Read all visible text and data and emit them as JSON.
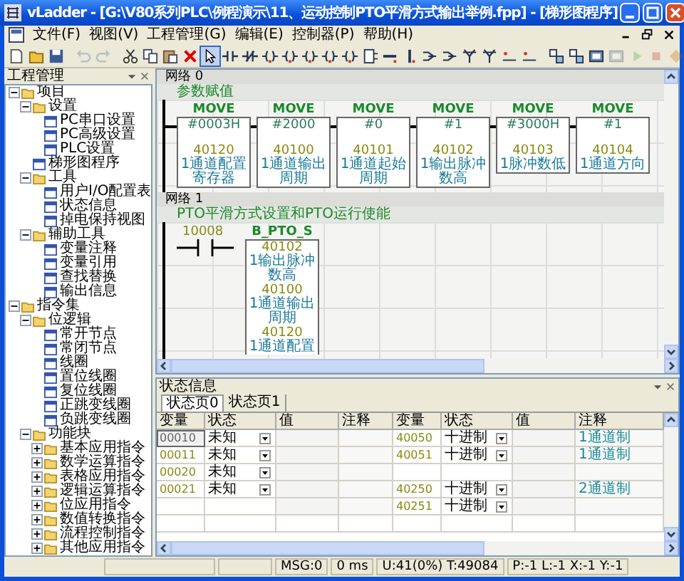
{
  "window": {
    "title": "vLadder - [G:\\V80系列PLC\\例程演示\\11、运动控制PTO平滑方式输出举例.fpp] - [梯形图程序]"
  },
  "menu": [
    "文件(F)",
    "视图(V)",
    "工程管理(G)",
    "编辑(E)",
    "控制器(P)",
    "帮助(H)"
  ],
  "toolbar": [
    {
      "kind": "new",
      "selected": false,
      "disabled": false
    },
    {
      "kind": "open",
      "selected": false,
      "disabled": false
    },
    {
      "kind": "save",
      "selected": false,
      "disabled": false
    },
    {
      "kind": "sep"
    },
    {
      "kind": "undo",
      "selected": false,
      "disabled": true
    },
    {
      "kind": "redo",
      "selected": false,
      "disabled": true
    },
    {
      "kind": "sep"
    },
    {
      "kind": "cut",
      "selected": false,
      "disabled": false
    },
    {
      "kind": "copy",
      "selected": false,
      "disabled": false
    },
    {
      "kind": "paste",
      "selected": false,
      "disabled": false
    },
    {
      "kind": "delete",
      "selected": false,
      "disabled": false
    },
    {
      "kind": "pointer",
      "selected": true,
      "disabled": false
    },
    {
      "kind": "contact",
      "selected": false,
      "disabled": false
    },
    {
      "kind": "contact_nc",
      "selected": false,
      "disabled": false
    },
    {
      "kind": "coil",
      "selected": false,
      "disabled": false
    },
    {
      "kind": "coil",
      "selected": false,
      "disabled": false
    },
    {
      "kind": "coil",
      "selected": false,
      "disabled": false
    },
    {
      "kind": "coil",
      "selected": false,
      "disabled": false
    },
    {
      "kind": "coil",
      "selected": false,
      "disabled": false
    },
    {
      "kind": "block",
      "selected": false,
      "disabled": false
    },
    {
      "kind": "hline",
      "selected": false,
      "disabled": false
    },
    {
      "kind": "vline",
      "selected": false,
      "disabled": false
    },
    {
      "kind": "branch",
      "selected": false,
      "disabled": false
    },
    {
      "kind": "branch",
      "selected": false,
      "disabled": false
    },
    {
      "kind": "fork",
      "selected": false,
      "disabled": false
    },
    {
      "kind": "fork",
      "selected": false,
      "disabled": false
    },
    {
      "kind": "link",
      "selected": false,
      "disabled": false
    },
    {
      "kind": "link",
      "selected": false,
      "disabled": false
    },
    {
      "kind": "sep"
    },
    {
      "kind": "monitor",
      "selected": false,
      "disabled": false
    },
    {
      "kind": "monitor",
      "selected": false,
      "disabled": false
    },
    {
      "kind": "download",
      "selected": false,
      "disabled": false
    },
    {
      "kind": "download",
      "selected": false,
      "disabled": true
    },
    {
      "kind": "run",
      "selected": false,
      "disabled": true
    },
    {
      "kind": "stop",
      "selected": false,
      "disabled": true
    },
    {
      "kind": "debug",
      "selected": false,
      "disabled": true
    }
  ],
  "project_panel": {
    "title": "工程管理",
    "tree": [
      {
        "label": "项目",
        "expanded": true,
        "children": [
          {
            "label": "设置",
            "expanded": true,
            "children": [
              {
                "label": "PC串口设置"
              },
              {
                "label": "PC高级设置"
              },
              {
                "label": "PLC设置"
              }
            ]
          },
          {
            "label": "梯形图程序"
          },
          {
            "label": "工具",
            "expanded": true,
            "children": [
              {
                "label": "用户I/O配置表"
              },
              {
                "label": "状态信息"
              },
              {
                "label": "掉电保持视图"
              }
            ]
          },
          {
            "label": "辅助工具",
            "expanded": true,
            "children": [
              {
                "label": "变量注释"
              },
              {
                "label": "变量引用"
              },
              {
                "label": "查找替换"
              },
              {
                "label": "输出信息"
              }
            ]
          }
        ]
      },
      {
        "label": "指令集",
        "expanded": true,
        "children": [
          {
            "label": "位逻辑",
            "expanded": true,
            "children": [
              {
                "label": "常开节点"
              },
              {
                "label": "常闭节点"
              },
              {
                "label": "线圈"
              },
              {
                "label": "置位线圈"
              },
              {
                "label": "复位线圈"
              },
              {
                "label": "正跳变线圈"
              },
              {
                "label": "负跳变线圈"
              }
            ]
          },
          {
            "label": "功能块",
            "expanded": true,
            "children": [
              {
                "label": "基本应用指令",
                "expanded": false
              },
              {
                "label": "数学运算指令",
                "expanded": false
              },
              {
                "label": "表格应用指令",
                "expanded": false
              },
              {
                "label": "逻辑运算指令",
                "expanded": false
              },
              {
                "label": "位应用指令",
                "expanded": false
              },
              {
                "label": "数值转换指令",
                "expanded": false
              },
              {
                "label": "流程控制指令",
                "expanded": false
              },
              {
                "label": "其他应用指令",
                "expanded": false
              }
            ]
          }
        ]
      }
    ]
  },
  "ladder": {
    "networks": [
      {
        "kind": "moves",
        "title": "网络 0",
        "comment": "参数赋值",
        "blocks": [
          {
            "name": "MOVE",
            "input": "#0003H",
            "output": "40120",
            "comment": "1通道配置寄存器"
          },
          {
            "name": "MOVE",
            "input": "#2000",
            "output": "40100",
            "comment": "1通道输出周期"
          },
          {
            "name": "MOVE",
            "input": "#0",
            "output": "40101",
            "comment": "1通道起始周期"
          },
          {
            "name": "MOVE",
            "input": "#1",
            "output": "40102",
            "comment": "1输出脉冲数高"
          },
          {
            "name": "MOVE",
            "input": "#3000H",
            "output": "40103",
            "comment": "1脉冲数低"
          },
          {
            "name": "MOVE",
            "input": "#1",
            "output": "40104",
            "comment": "1通道方向"
          }
        ]
      },
      {
        "kind": "contact_block",
        "title": "网络 1",
        "comment": "PTO平滑方式设置和PTO运行使能",
        "contact": "10008",
        "block": {
          "name": "B_PTO_S",
          "params": [
            {
              "address": "40102",
              "comment": "1输出脉冲数高"
            },
            {
              "address": "40100",
              "comment": "1通道输出周期"
            },
            {
              "address": "40120",
              "comment": "1通道配置"
            }
          ]
        }
      }
    ]
  },
  "status_panel": {
    "title": "状态信息",
    "tabs": [
      {
        "label": "状态页0",
        "selected": true
      },
      {
        "label": "状态页1",
        "selected": false
      }
    ],
    "columns": [
      "变量",
      "状态",
      "值",
      "注释",
      "变量",
      "状态",
      "值",
      "注释"
    ],
    "rows": [
      {
        "left": {
          "variable": "00010",
          "status": "未知"
        },
        "right": {
          "variable": "40050",
          "status": "十进制",
          "comment": "1通道制"
        }
      },
      {
        "left": {
          "variable": "00011",
          "status": "未知"
        },
        "right": {
          "variable": "40051",
          "status": "十进制",
          "comment": "1通道制"
        }
      },
      {
        "left": {
          "variable": "00020",
          "status": "未知"
        },
        "right": {}
      },
      {
        "left": {
          "variable": "00021",
          "status": "未知"
        },
        "right": {
          "variable": "40250",
          "status": "十进制",
          "comment": "2通道制"
        }
      },
      {
        "left": {},
        "right": {
          "variable": "40251",
          "status": "十进制"
        }
      }
    ]
  },
  "status_bar": [
    "MSG:0",
    "0 ms",
    "U:41(0%) T:49084",
    "P:-1 L:-1 X:-1 Y:-1"
  ]
}
